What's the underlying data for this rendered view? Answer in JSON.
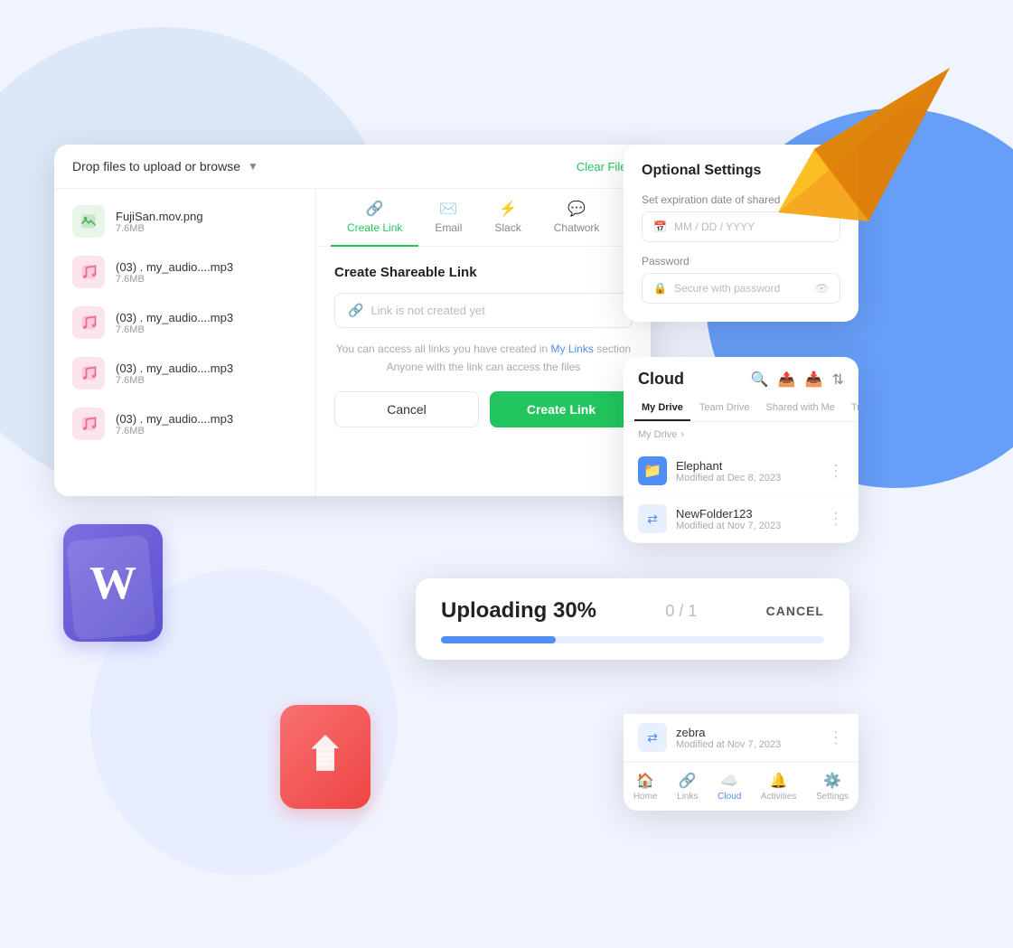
{
  "background": {
    "circle_left_color": "#dce8f8",
    "circle_right_color": "#4f8ef7",
    "circle_bottom_color": "#e8eeff"
  },
  "upload_panel": {
    "header": {
      "drop_label": "Drop files to upload or browse",
      "clear_label": "Clear Files"
    },
    "files": [
      {
        "name": "FujiSan.mov.png",
        "size": "7.6MB",
        "type": "image"
      },
      {
        "name": "(03) . my_audio....mp3",
        "size": "7.6MB",
        "type": "audio"
      },
      {
        "name": "(03) . my_audio....mp3",
        "size": "7.6MB",
        "type": "audio"
      },
      {
        "name": "(03) . my_audio....mp3",
        "size": "7.6MB",
        "type": "audio"
      },
      {
        "name": "(03) . my_audio....mp3",
        "size": "7.6MB",
        "type": "audio"
      }
    ],
    "tabs": [
      {
        "id": "create-link",
        "label": "Create Link",
        "icon": "🔗",
        "active": true
      },
      {
        "id": "email",
        "label": "Email",
        "icon": "✉️",
        "active": false
      },
      {
        "id": "slack",
        "label": "Slack",
        "icon": "⚡",
        "active": false
      },
      {
        "id": "chatwork",
        "label": "Chatwork",
        "icon": "💬",
        "active": false
      }
    ],
    "create_link": {
      "title": "Create Shareable Link",
      "placeholder": "Link is not created yet",
      "info_text_1": "You can access all links you have created in",
      "info_link_text": "My Links",
      "info_text_2": "section",
      "anyone_text": "Anyone with the link can access the files"
    },
    "buttons": {
      "cancel": "Cancel",
      "create": "Create Link"
    }
  },
  "optional_settings": {
    "title": "Optional Settings",
    "expiry_label": "Set expiration date of shared",
    "date_placeholder": "MM / DD / YYYY",
    "password_label": "Password",
    "password_placeholder": "Secure with password"
  },
  "cloud_panel": {
    "title": "Cloud",
    "tabs": [
      "My Drive",
      "Team Drive",
      "Shared with Me",
      "Trash"
    ],
    "active_tab": "My Drive",
    "breadcrumb": [
      "My Drive",
      ">"
    ],
    "folders": [
      {
        "name": "Elephant",
        "date": "Modified at Dec 8, 2023",
        "type": "blue"
      },
      {
        "name": "NewFolder123",
        "date": "Modified at Nov 7, 2023",
        "type": "share"
      },
      {
        "name": "zebra",
        "date": "Modified at Nov 7, 2023",
        "type": "share"
      }
    ],
    "bottom_nav": [
      {
        "label": "Home",
        "icon": "🏠",
        "active": false
      },
      {
        "label": "Links",
        "icon": "🔗",
        "active": false
      },
      {
        "label": "Cloud",
        "icon": "☁️",
        "active": true
      },
      {
        "label": "Activities",
        "icon": "🔔",
        "active": false
      },
      {
        "label": "Settings",
        "icon": "⚙️",
        "active": false
      }
    ]
  },
  "upload_progress": {
    "label": "Uploading 30%",
    "percent": 30,
    "count": "0 / 1",
    "cancel": "CANCEL",
    "bar_fill_percent": 30
  },
  "word_icon": {
    "letter": "W"
  },
  "pdf_icon": {
    "symbol": "✦"
  }
}
